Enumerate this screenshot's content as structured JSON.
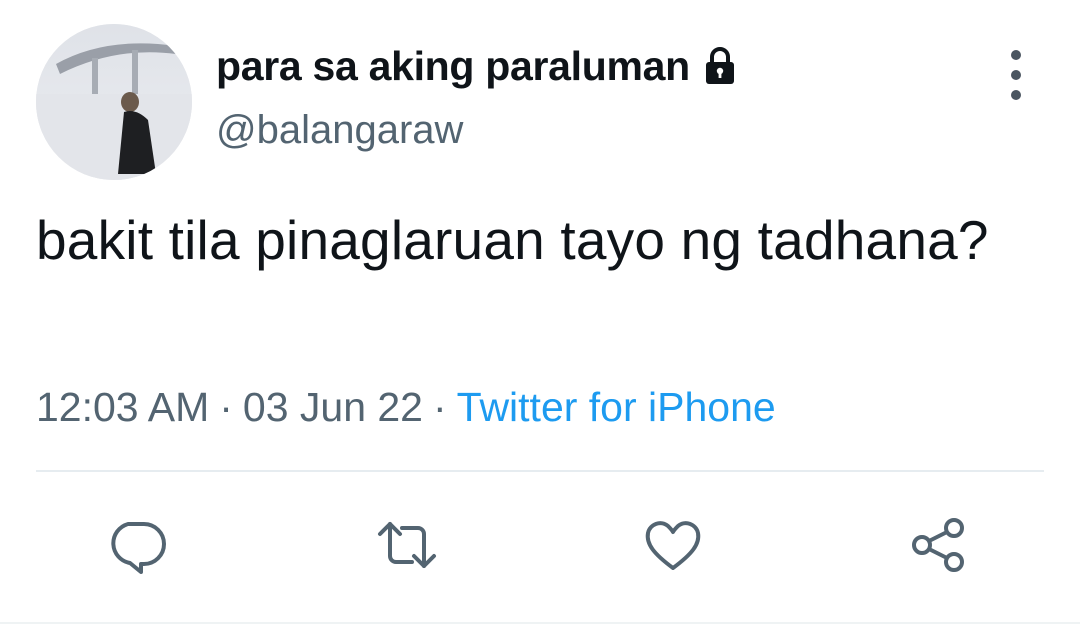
{
  "user": {
    "display_name": "para sa aking paraluman",
    "handle": "@balangaraw",
    "protected_icon": "lock-icon"
  },
  "tweet": {
    "text": "bakit tila pinaglaruan tayo ng tadhana?",
    "time": "12:03 AM",
    "date": "03 Jun 22",
    "source": "Twitter for iPhone",
    "separator": "·"
  },
  "actions": [
    {
      "name": "reply",
      "icon": "reply-icon"
    },
    {
      "name": "retweet",
      "icon": "retweet-icon"
    },
    {
      "name": "like",
      "icon": "heart-icon"
    },
    {
      "name": "share",
      "icon": "share-icon"
    }
  ],
  "colors": {
    "text_primary": "#0f1419",
    "text_secondary": "#536471",
    "link": "#1d9bf0",
    "icon": "#536471",
    "divider": "#e6ecf0"
  }
}
